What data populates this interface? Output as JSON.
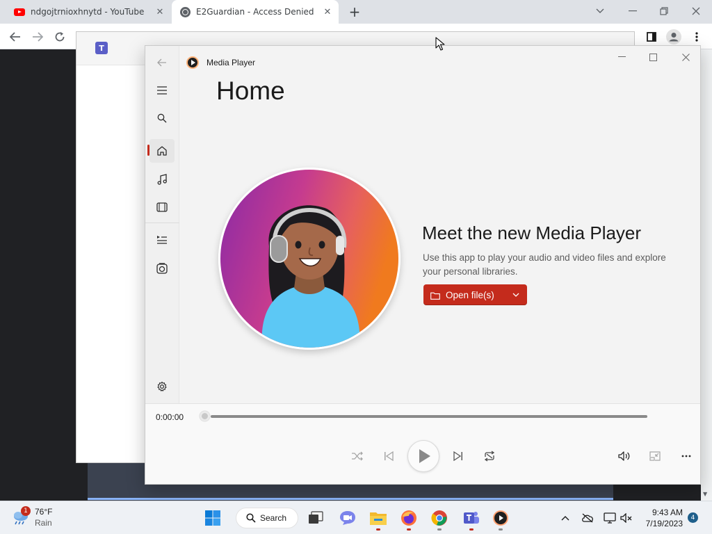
{
  "browser": {
    "tabs": [
      {
        "title": "ndgojtrnioxhnytd - YouTube",
        "favicon": "youtube-icon"
      },
      {
        "title": "E2Guardian - Access Denied",
        "favicon": "globe-icon",
        "active": true
      }
    ],
    "new_tab": "+"
  },
  "media_player": {
    "title": "Media Player",
    "page_title": "Home",
    "nav": [
      "back-icon",
      "menu-icon",
      "search-icon",
      "home-icon",
      "music-icon",
      "video-icon",
      "playlist-icon",
      "library-icon",
      "settings-icon"
    ],
    "active_nav": "home",
    "headline": "Meet the new Media Player",
    "description": "Use this app to play your audio and video files and explore your personal libraries.",
    "open_button": "Open file(s)",
    "current_time": "0:00:00",
    "progress": 0,
    "accent_color": "#c42b1c"
  },
  "taskbar": {
    "weather_badge": "1",
    "weather_temp": "76°F",
    "weather_condition": "Rain",
    "search_label": "Search",
    "time": "9:43 AM",
    "date": "7/19/2023",
    "notification_count": "4"
  }
}
